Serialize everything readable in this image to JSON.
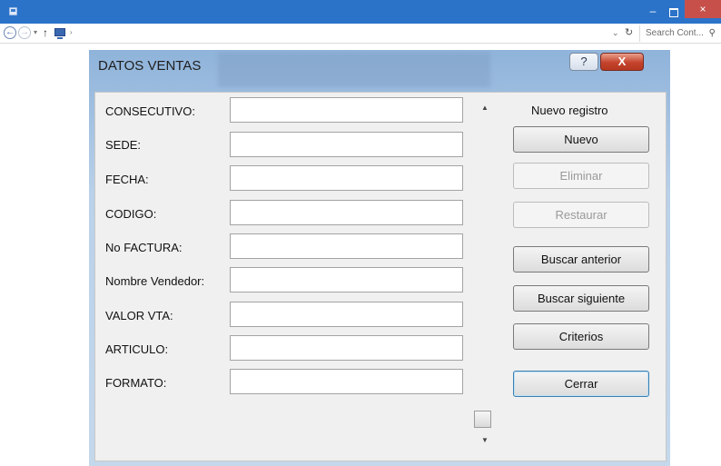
{
  "window": {
    "min_glyph": "–",
    "close_glyph": "×"
  },
  "addressbar": {
    "back_glyph": "←",
    "forward_glyph": "→",
    "up_glyph": "↑",
    "search_placeholder": "Search Cont...",
    "search_glyph": "⚲"
  },
  "dialog": {
    "title": "DATOS VENTAS",
    "help_label": "?",
    "close_label": "X",
    "fields": [
      {
        "label": "CONSECUTIVO:",
        "value": ""
      },
      {
        "label": "SEDE:",
        "value": ""
      },
      {
        "label": "FECHA:",
        "value": ""
      },
      {
        "label": "CODIGO:",
        "value": ""
      },
      {
        "label": "No FACTURA:",
        "value": ""
      },
      {
        "label": "Nombre Vendedor:",
        "value": ""
      },
      {
        "label": "VALOR VTA:",
        "value": ""
      },
      {
        "label": "ARTICULO:",
        "value": ""
      },
      {
        "label": "FORMATO:",
        "value": ""
      }
    ],
    "record_status": "Nuevo registro",
    "buttons": {
      "nuevo": "Nuevo",
      "eliminar": "Eliminar",
      "restaurar": "Restaurar",
      "buscar_anterior": "Buscar anterior",
      "buscar_siguiente": "Buscar siguiente",
      "criterios": "Criterios",
      "cerrar": "Cerrar"
    }
  },
  "colors": {
    "titlebar": "#2b73c9",
    "close_red": "#c7504a",
    "panel": "#f0f0f0"
  }
}
